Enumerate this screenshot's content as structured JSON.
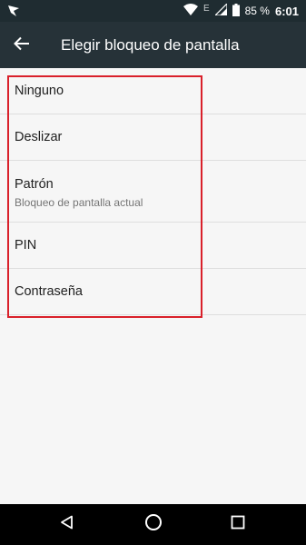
{
  "status_bar": {
    "network_indicator": "E",
    "battery_percent": "85 %",
    "time": "6:01",
    "icons": [
      "app-notification-icon",
      "wifi-icon",
      "signal-icon",
      "battery-icon"
    ]
  },
  "app_bar": {
    "title": "Elegir bloqueo de pantalla",
    "back_icon": "arrow-left-icon"
  },
  "options": [
    {
      "label": "Ninguno",
      "subtitle": ""
    },
    {
      "label": "Deslizar",
      "subtitle": ""
    },
    {
      "label": "Patrón",
      "subtitle": "Bloqueo de pantalla actual"
    },
    {
      "label": "PIN",
      "subtitle": ""
    },
    {
      "label": "Contraseña",
      "subtitle": ""
    }
  ],
  "colors": {
    "status_bar": "#1f2c31",
    "app_bar": "#263238",
    "background": "#f6f6f6",
    "highlight": "#d9202a",
    "nav_bar": "#000000"
  },
  "nav_bar": {
    "icons": [
      "back-triangle-icon",
      "home-circle-icon",
      "recents-square-icon"
    ]
  }
}
